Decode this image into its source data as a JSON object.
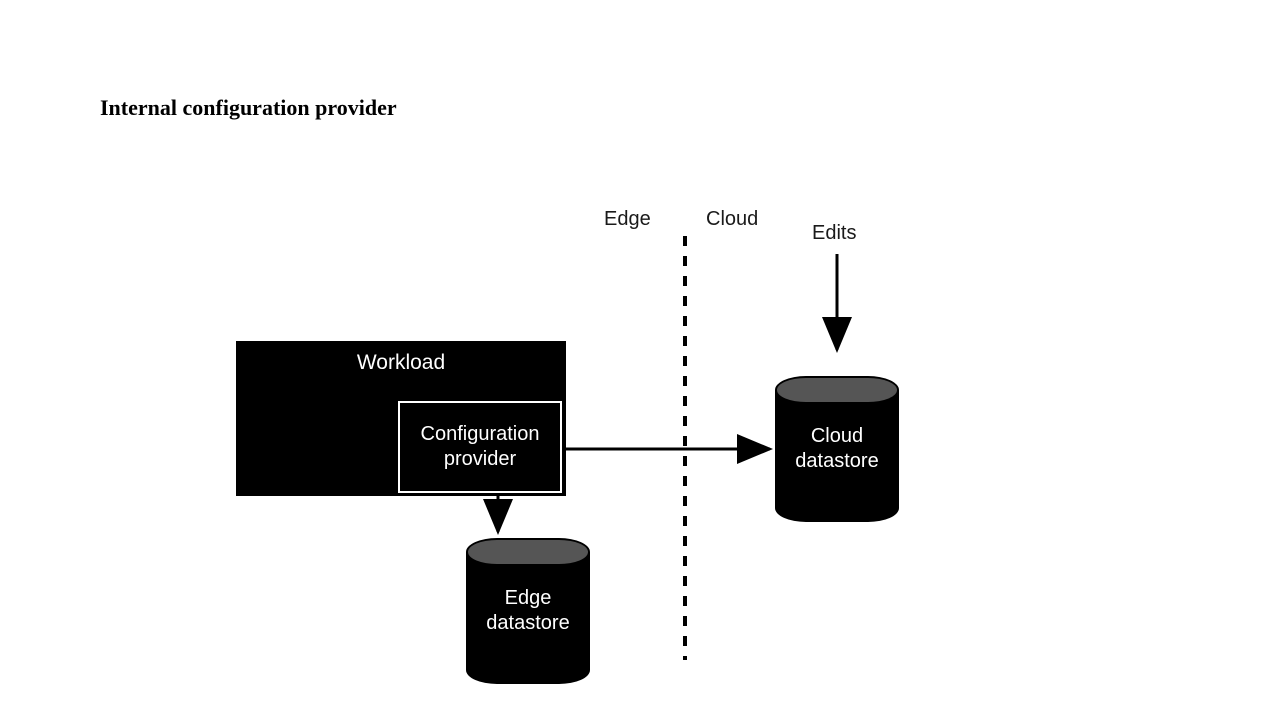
{
  "title": "Internal configuration provider",
  "labels": {
    "edge": "Edge",
    "cloud": "Cloud",
    "edits": "Edits"
  },
  "nodes": {
    "workload": "Workload",
    "config_provider": "Configuration provider",
    "edge_datastore": "Edge datastore",
    "cloud_datastore": "Cloud datastore"
  },
  "diagram": {
    "divider": {
      "edge_side": "Edge",
      "cloud_side": "Cloud"
    },
    "arrows": [
      {
        "from": "config_provider",
        "to": "cloud_datastore"
      },
      {
        "from": "config_provider",
        "to": "edge_datastore"
      },
      {
        "from": "edits_label",
        "to": "cloud_datastore"
      }
    ]
  }
}
